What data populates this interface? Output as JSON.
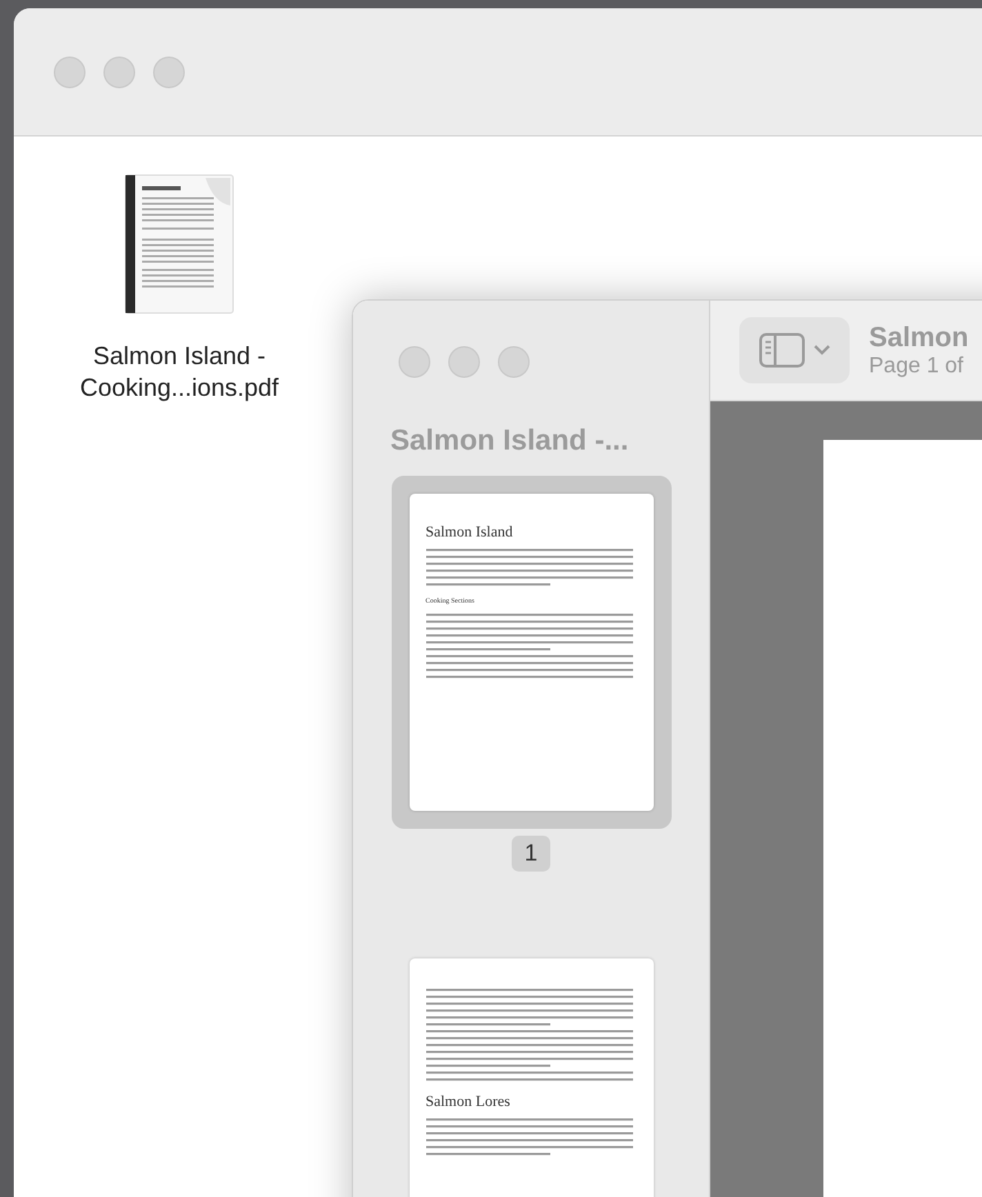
{
  "finder_window": {
    "file": {
      "name": "Salmon Island - Cooking...ions.pdf",
      "kind": "picture"
    }
  },
  "preview_window": {
    "sidebar": {
      "title": "Salmon Island -...",
      "pages": [
        {
          "number": "1",
          "selected": true,
          "headings": [
            "Salmon Island",
            "Cooking Sections"
          ]
        },
        {
          "selected": false,
          "headings": [
            "Salmon Lores"
          ]
        }
      ]
    },
    "toolbar": {
      "title": "Salmon",
      "subtitle": "Page 1 of"
    }
  }
}
